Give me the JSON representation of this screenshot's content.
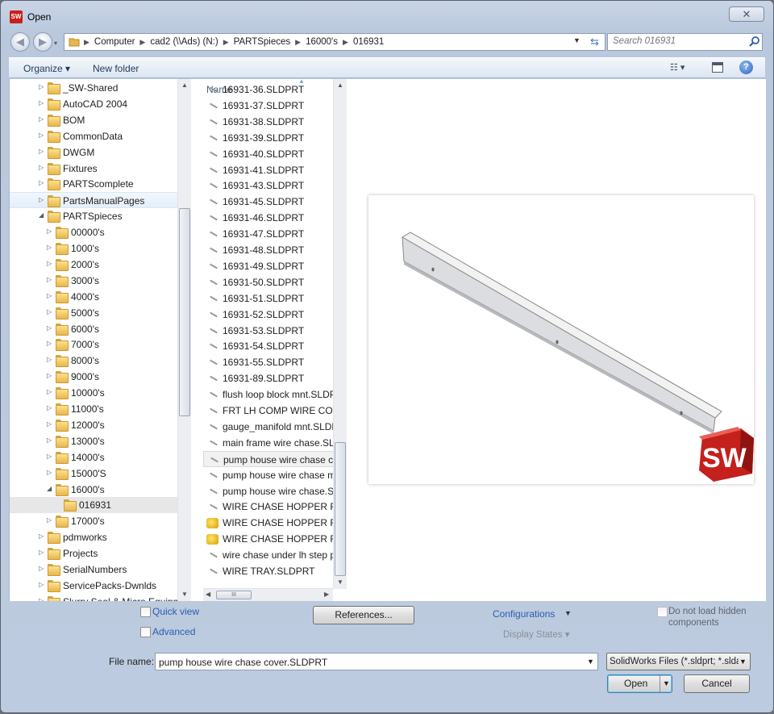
{
  "window": {
    "title": "Open",
    "app_icon": "solidworks-logo",
    "close_label": "✕"
  },
  "nav": {
    "breadcrumbs": [
      "Computer",
      "cad2 (\\\\Ads) (N:)",
      "PARTSpieces",
      "16000's",
      "016931"
    ],
    "search_placeholder": "Search 016931"
  },
  "toolbar": {
    "organize": "Organize ▾",
    "new_folder": "New folder",
    "help": "?"
  },
  "tree": [
    {
      "label": "_SW-Shared",
      "indent": 0,
      "arrow": "▷"
    },
    {
      "label": "AutoCAD 2004",
      "indent": 0,
      "arrow": "▷"
    },
    {
      "label": "BOM",
      "indent": 0,
      "arrow": "▷"
    },
    {
      "label": "CommonData",
      "indent": 0,
      "arrow": "▷"
    },
    {
      "label": "DWGM",
      "indent": 0,
      "arrow": "▷"
    },
    {
      "label": "Fixtures",
      "indent": 0,
      "arrow": "▷"
    },
    {
      "label": "PARTScomplete",
      "indent": 0,
      "arrow": "▷"
    },
    {
      "label": "PartsManualPages",
      "indent": 0,
      "arrow": "▷",
      "state": "hover"
    },
    {
      "label": "PARTSpieces",
      "indent": 0,
      "arrow": "◢"
    },
    {
      "label": "00000's",
      "indent": 1,
      "arrow": "▷"
    },
    {
      "label": "1000's",
      "indent": 1,
      "arrow": "▷"
    },
    {
      "label": "2000's",
      "indent": 1,
      "arrow": "▷"
    },
    {
      "label": "3000's",
      "indent": 1,
      "arrow": "▷"
    },
    {
      "label": "4000's",
      "indent": 1,
      "arrow": "▷"
    },
    {
      "label": "5000's",
      "indent": 1,
      "arrow": "▷"
    },
    {
      "label": "6000's",
      "indent": 1,
      "arrow": "▷"
    },
    {
      "label": "7000's",
      "indent": 1,
      "arrow": "▷"
    },
    {
      "label": "8000's",
      "indent": 1,
      "arrow": "▷"
    },
    {
      "label": "9000's",
      "indent": 1,
      "arrow": "▷"
    },
    {
      "label": "10000's",
      "indent": 1,
      "arrow": "▷"
    },
    {
      "label": "11000's",
      "indent": 1,
      "arrow": "▷"
    },
    {
      "label": "12000's",
      "indent": 1,
      "arrow": "▷"
    },
    {
      "label": "13000's",
      "indent": 1,
      "arrow": "▷"
    },
    {
      "label": "14000's",
      "indent": 1,
      "arrow": "▷"
    },
    {
      "label": "15000'S",
      "indent": 1,
      "arrow": "▷"
    },
    {
      "label": "16000's",
      "indent": 1,
      "arrow": "◢"
    },
    {
      "label": "016931",
      "indent": 2,
      "arrow": "",
      "state": "selected"
    },
    {
      "label": "17000's",
      "indent": 1,
      "arrow": "▷"
    },
    {
      "label": "pdmworks",
      "indent": 0,
      "arrow": "▷"
    },
    {
      "label": "Projects",
      "indent": 0,
      "arrow": "▷"
    },
    {
      "label": "SerialNumbers",
      "indent": 0,
      "arrow": "▷"
    },
    {
      "label": "ServicePacks-Dwnlds",
      "indent": 0,
      "arrow": "▷"
    },
    {
      "label": "Slurry Seal & Micro Equipment",
      "indent": 0,
      "arrow": "▷"
    }
  ],
  "files": {
    "column": "Name",
    "items": [
      {
        "name": "16931-36.SLDPRT"
      },
      {
        "name": "16931-37.SLDPRT"
      },
      {
        "name": "16931-38.SLDPRT"
      },
      {
        "name": "16931-39.SLDPRT"
      },
      {
        "name": "16931-40.SLDPRT"
      },
      {
        "name": "16931-41.SLDPRT"
      },
      {
        "name": "16931-43.SLDPRT"
      },
      {
        "name": "16931-45.SLDPRT"
      },
      {
        "name": "16931-46.SLDPRT"
      },
      {
        "name": "16931-47.SLDPRT"
      },
      {
        "name": "16931-48.SLDPRT"
      },
      {
        "name": "16931-49.SLDPRT"
      },
      {
        "name": "16931-50.SLDPRT"
      },
      {
        "name": "16931-51.SLDPRT"
      },
      {
        "name": "16931-52.SLDPRT"
      },
      {
        "name": "16931-53.SLDPRT"
      },
      {
        "name": "16931-54.SLDPRT"
      },
      {
        "name": "16931-55.SLDPRT"
      },
      {
        "name": "16931-89.SLDPRT"
      },
      {
        "name": "flush loop block mnt.SLDPRT"
      },
      {
        "name": "FRT LH COMP WIRE COVER"
      },
      {
        "name": "gauge_manifold mnt.SLDPRT"
      },
      {
        "name": "main frame wire chase.SLDPRT"
      },
      {
        "name": "pump house wire chase cover",
        "state": "selected"
      },
      {
        "name": "pump house wire chase mnt"
      },
      {
        "name": "pump house wire chase.SLDPRT"
      },
      {
        "name": "WIRE CHASE HOPPER FRT W"
      },
      {
        "name": "WIRE CHASE HOPPER FRT W",
        "icon": "warning"
      },
      {
        "name": "WIRE CHASE HOPPER FRT W",
        "icon": "warning"
      },
      {
        "name": "wire chase under lh step plate"
      },
      {
        "name": "WIRE TRAY.SLDPRT"
      }
    ]
  },
  "preview": {
    "logo_text": "SW"
  },
  "options": {
    "quick_view": "Quick view",
    "advanced": "Advanced",
    "references": "References...",
    "configurations": "Configurations",
    "display_states": "Display States ▾",
    "do_not_load": "Do not load hidden components"
  },
  "file": {
    "name_label": "File name:",
    "name_value": "pump house wire chase cover.SLDPRT",
    "type_value": "SolidWorks Files (*.sldprt; *.sldasm; *.slddrw)",
    "open": "Open",
    "cancel": "Cancel"
  }
}
